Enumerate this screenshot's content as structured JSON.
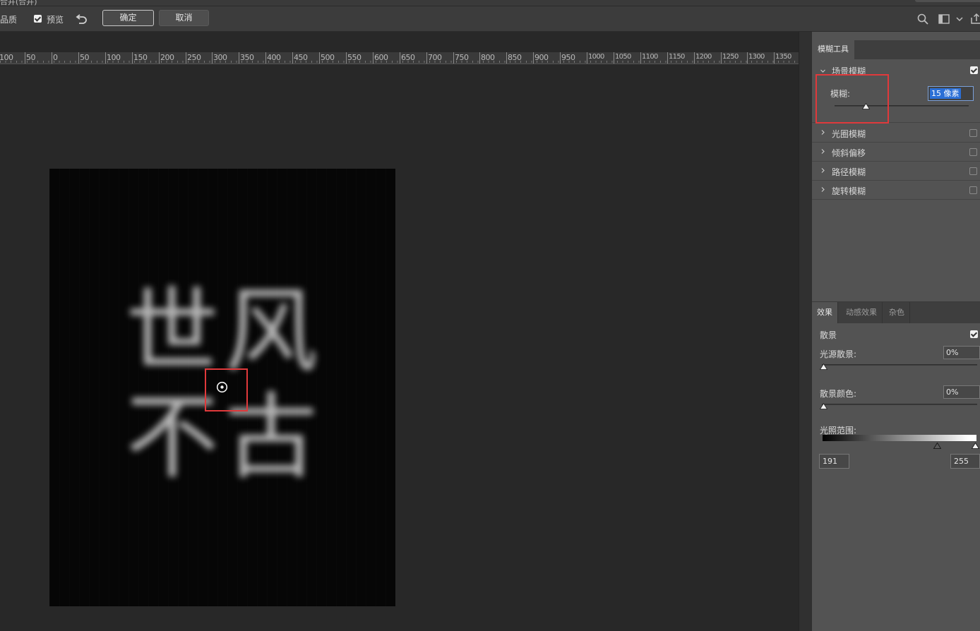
{
  "window": {
    "title_fragment": "合并(合并)"
  },
  "options_bar": {
    "quality_label": "高品质",
    "preview_label": "预览",
    "preview_checked": true,
    "ok_label": "确定",
    "cancel_label": "取消"
  },
  "ruler": {
    "labels": [
      "100",
      "50",
      "0",
      "50",
      "100",
      "150",
      "200",
      "250",
      "300",
      "350",
      "400",
      "450",
      "500",
      "550",
      "600",
      "650",
      "700",
      "750",
      "800",
      "850",
      "900",
      "950",
      "1000",
      "1050",
      "1100",
      "1150",
      "1200",
      "1250",
      "1300",
      "1350"
    ]
  },
  "canvas": {
    "glyphs": [
      "世",
      "风",
      "不",
      "古"
    ]
  },
  "blur_tools_panel": {
    "tab_label": "模糊工具",
    "sections": [
      {
        "label": "场景模糊",
        "expanded": true,
        "checked": true
      },
      {
        "label": "光圈模糊",
        "expanded": false,
        "checked": false
      },
      {
        "label": "倾斜偏移",
        "expanded": false,
        "checked": false
      },
      {
        "label": "路径模糊",
        "expanded": false,
        "checked": false
      },
      {
        "label": "旋转模糊",
        "expanded": false,
        "checked": false
      }
    ],
    "blur_label": "模糊:",
    "blur_value": "15 像素",
    "blur_amount": 15
  },
  "effects_panel": {
    "tabs": [
      "效果",
      "动感效果",
      "杂色"
    ],
    "bokeh_label": "散景",
    "bokeh_checked": true,
    "light_bokeh_label": "光源散景:",
    "light_bokeh_value": "0%",
    "bokeh_color_label": "散景颜色:",
    "bokeh_color_value": "0%",
    "light_range_label": "光照范围:",
    "light_range_min": "191",
    "light_range_max": "255"
  },
  "colors": {
    "highlight_box": "#e0393b",
    "selection": "#2b6fd6"
  }
}
